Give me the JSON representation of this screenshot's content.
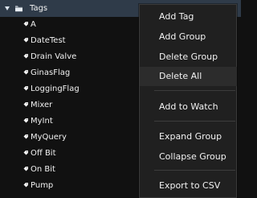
{
  "tree": {
    "root_label": "Tags",
    "items": [
      {
        "label": "A"
      },
      {
        "label": "DateTest"
      },
      {
        "label": "Drain Valve"
      },
      {
        "label": "GinasFlag"
      },
      {
        "label": "LoggingFlag"
      },
      {
        "label": "Mixer"
      },
      {
        "label": "MyInt"
      },
      {
        "label": "MyQuery"
      },
      {
        "label": "Off Bit"
      },
      {
        "label": "On Bit"
      },
      {
        "label": "Pump"
      }
    ]
  },
  "context_menu": {
    "items": [
      {
        "label": "Add Tag"
      },
      {
        "label": "Add Group"
      },
      {
        "label": "Delete Group"
      },
      {
        "label": "Delete All"
      },
      {
        "label": "Add to Watch"
      },
      {
        "label": "Expand Group"
      },
      {
        "label": "Collapse Group"
      },
      {
        "label": "Export to CSV"
      }
    ]
  },
  "icons": {
    "root": "folder-icon",
    "item": "tag-icon",
    "expand": "expand-triangle-icon"
  },
  "colors": {
    "background": "#111111",
    "tree_header": "#2f3b49",
    "menu_background": "#202020",
    "menu_hover": "#2c2c2c",
    "separator": "#3c3c3c",
    "text": "#f2f2f2"
  }
}
